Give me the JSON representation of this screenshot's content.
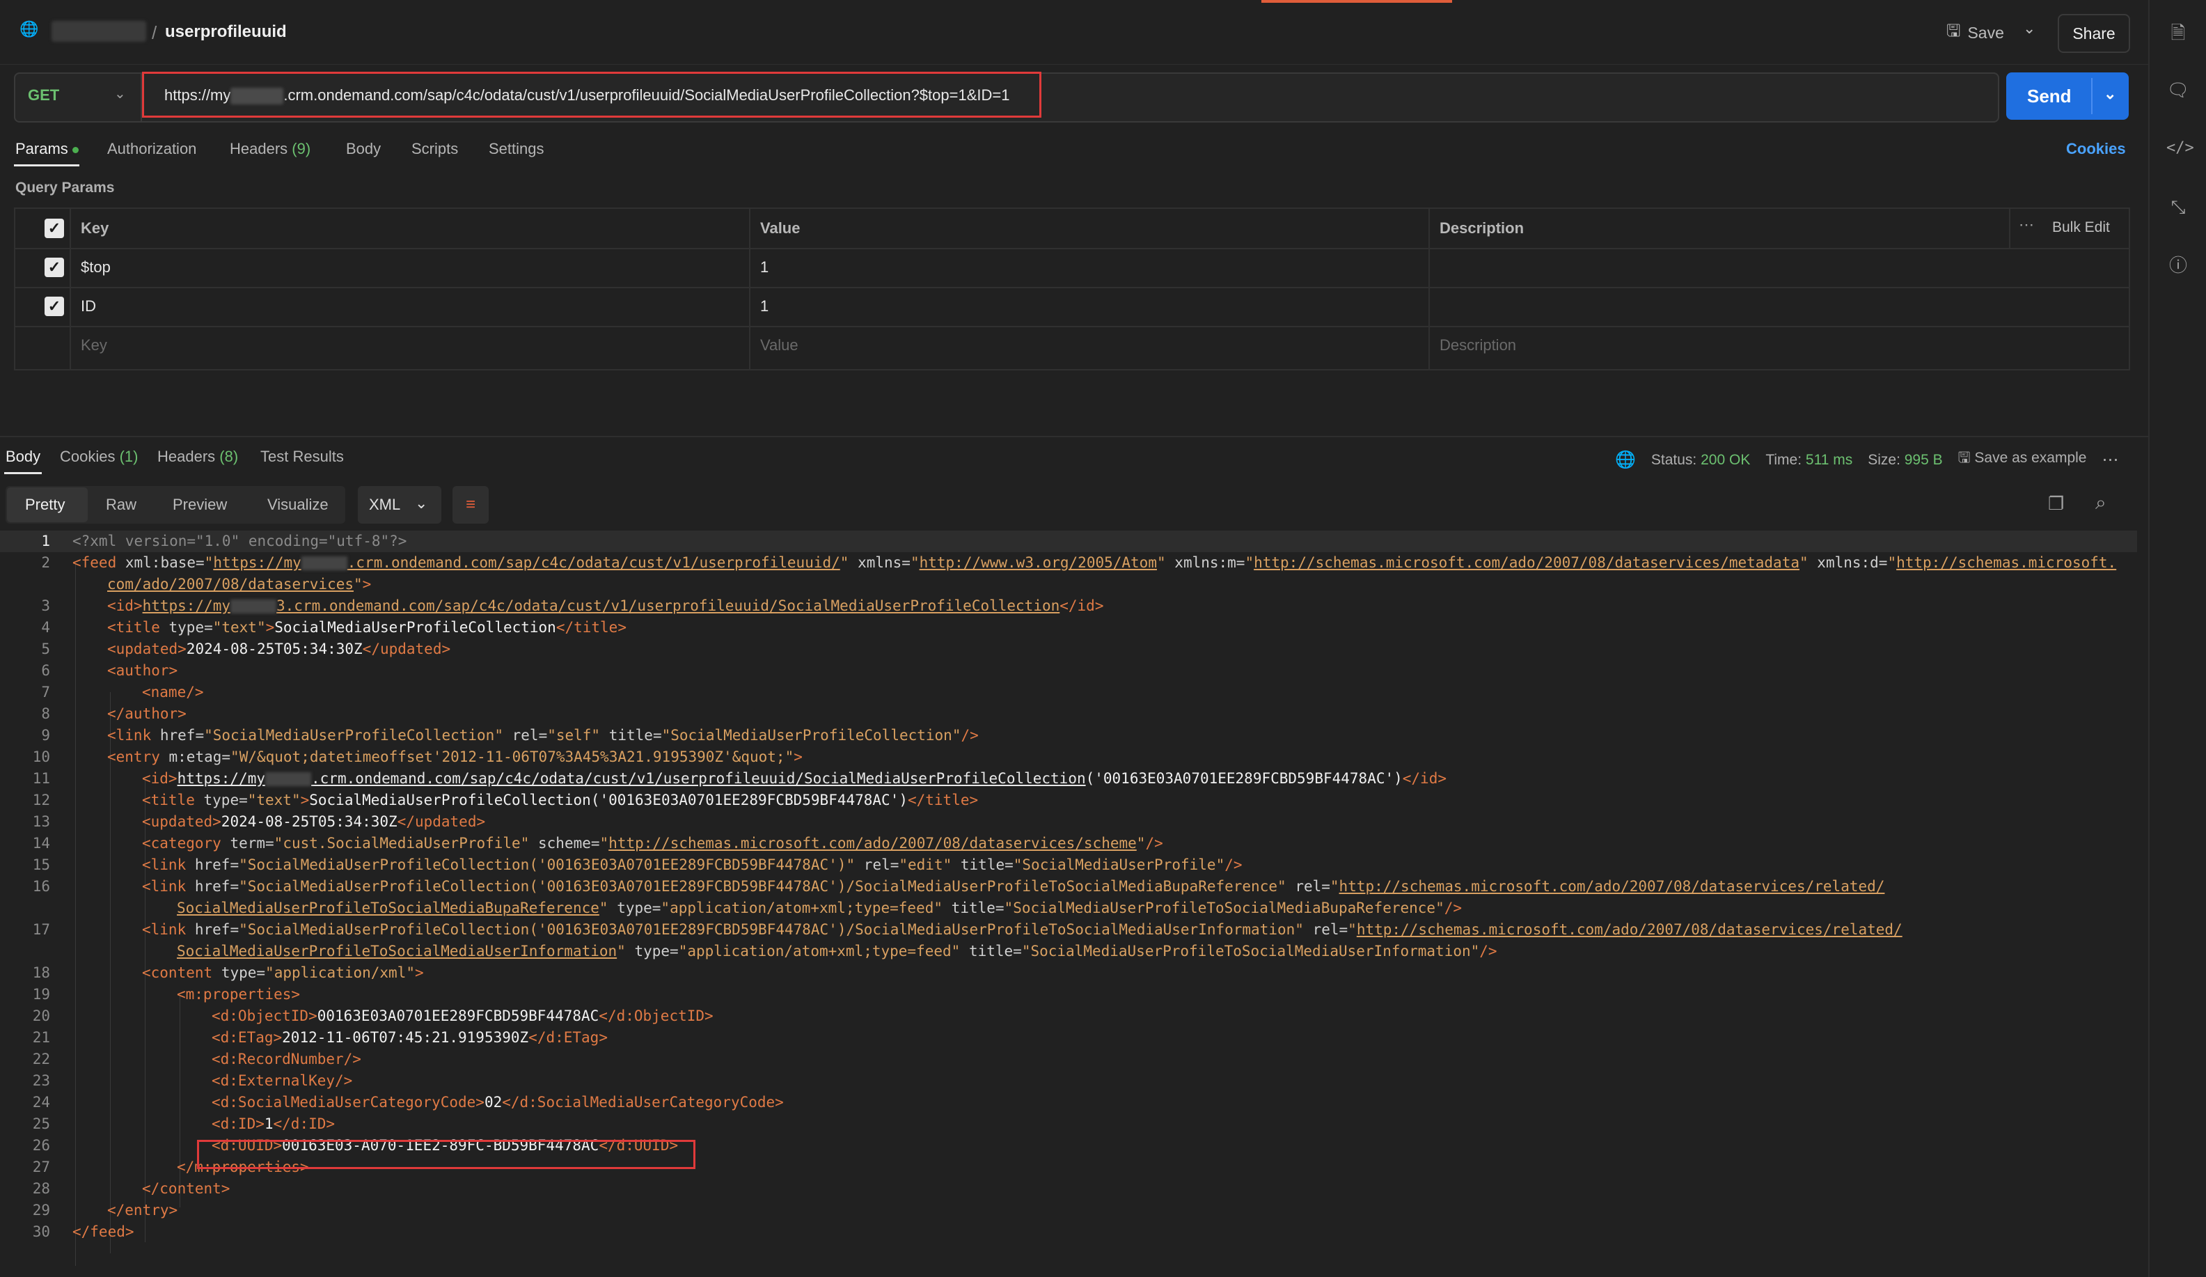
{
  "header": {
    "breadcrumb_sep": "/",
    "request_name": "userprofileuuid",
    "save_label": "Save",
    "share_label": "Share"
  },
  "request": {
    "method": "GET",
    "url_prefix": "https://my",
    "url_suffix": ".crm.ondemand.com/sap/c4c/odata/cust/v1/userprofileuuid/SocialMediaUserProfileCollection?$top=1&ID=1",
    "send_label": "Send"
  },
  "request_tabs": {
    "params": "Params",
    "authorization": "Authorization",
    "headers": "Headers",
    "headers_count": "(9)",
    "body": "Body",
    "scripts": "Scripts",
    "settings": "Settings",
    "cookies": "Cookies"
  },
  "query_params": {
    "title": "Query Params",
    "columns": [
      "Key",
      "Value",
      "Description"
    ],
    "bulk_edit": "Bulk Edit",
    "rows": [
      {
        "key": "$top",
        "value": "1",
        "description": ""
      },
      {
        "key": "ID",
        "value": "1",
        "description": ""
      }
    ],
    "placeholder": {
      "key": "Key",
      "value": "Value",
      "description": "Description"
    }
  },
  "response": {
    "tabs": {
      "body": "Body",
      "cookies": "Cookies",
      "cookies_count": "(1)",
      "headers": "Headers",
      "headers_count": "(8)",
      "tests": "Test Results"
    },
    "status_label": "Status:",
    "status_value": "200 OK",
    "time_label": "Time:",
    "time_value": "511 ms",
    "size_label": "Size:",
    "size_value": "995 B",
    "save_example": "Save as example",
    "view_tabs": [
      "Pretty",
      "Raw",
      "Preview",
      "Visualize"
    ],
    "format": "XML"
  },
  "code": {
    "l1": "<?xml version=\"1.0\" encoding=\"utf-8\"?>",
    "l2_base_suffix": ".crm.ondemand.com/sap/c4c/odata/cust/v1/userprofileuuid/",
    "l2_xmlns": "http://www.w3.org/2005/Atom",
    "l2_xmlns_m": "http://schemas.microsoft.com/ado/2007/08/dataservices/metadata",
    "l2_xmlns_d": "http://schemas.microsoft.",
    "l2b": "com/ado/2007/08/dataservices",
    "l3_url_prefix": "https://my",
    "l3_url_suffix": "3.crm.ondemand.com/sap/c4c/odata/cust/v1/userprofileuuid/SocialMediaUserProfileCollection",
    "l4_title": "SocialMediaUserProfileCollection",
    "l5_updated": "2024-08-25T05:34:30Z",
    "l9_href": "SocialMediaUserProfileCollection",
    "l9_title": "SocialMediaUserProfileCollection",
    "l10_etag": "W/&quot;datetimeoffset'2012-11-06T07%3A45%3A21.9195390Z'&quot;",
    "l11_url_suffix": ".crm.ondemand.com/sap/c4c/odata/cust/v1/userprofileuuid/SocialMediaUserProfileCollection",
    "l11_key": "('00163E03A0701EE289FCBD59BF4478AC')",
    "l12_title": "SocialMediaUserProfileCollection('00163E03A0701EE289FCBD59BF4478AC')",
    "l13_updated": "2024-08-25T05:34:30Z",
    "l14_term": "cust.SocialMediaUserProfile",
    "l14_scheme": "http://schemas.microsoft.com/ado/2007/08/dataservices/scheme",
    "l15_href": "SocialMediaUserProfileCollection('00163E03A0701EE289FCBD59BF4478AC')",
    "l15_title": "SocialMediaUserProfile",
    "l16_href": "SocialMediaUserProfileCollection('00163E03A0701EE289FCBD59BF4478AC')/SocialMediaUserProfileToSocialMediaBupaReference",
    "l16_rel": "http://schemas.microsoft.com/ado/2007/08/dataservices/related/",
    "l16b_rel": "SocialMediaUserProfileToSocialMediaBupaReference",
    "l16b_title": "SocialMediaUserProfileToSocialMediaBupaReference",
    "l17_href": "SocialMediaUserProfileCollection('00163E03A0701EE289FCBD59BF4478AC')/SocialMediaUserProfileToSocialMediaUserInformation",
    "l17_rel": "http://schemas.microsoft.com/ado/2007/08/dataservices/related/",
    "l17b_rel": "SocialMediaUserProfileToSocialMediaUserInformation",
    "l17b_title": "SocialMediaUserProfileToSocialMediaUserInformation",
    "feed_type": "application/atom+xml;type=feed",
    "content_type": "application/xml",
    "object_id": "00163E03A0701EE289FCBD59BF4478AC",
    "etag": "2012-11-06T07:45:21.9195390Z",
    "category_code": "02",
    "id_value": "1",
    "uuid": "00163E03-A070-1EE2-89FC-BD59BF4478AC"
  }
}
